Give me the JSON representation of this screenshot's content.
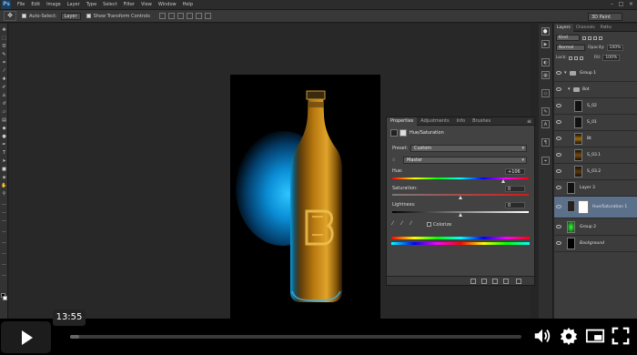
{
  "app": {
    "logo": "Ps",
    "menus": [
      "File",
      "Edit",
      "Image",
      "Layer",
      "Type",
      "Select",
      "Filter",
      "View",
      "Window",
      "Help"
    ],
    "window_controls": [
      "–",
      "□",
      "×"
    ]
  },
  "options_bar": {
    "auto_select_label": "Auto-Select:",
    "auto_select_value": "Layer",
    "show_transform_label": "Show Transform Controls",
    "workspace": "3D Paint"
  },
  "properties_panel": {
    "tabs": [
      "Properties",
      "Adjustments",
      "Info",
      "Brushes"
    ],
    "title": "Hue/Saturation",
    "preset_label": "Preset:",
    "preset_value": "Custom",
    "channel_value": "Master",
    "hue_label": "Hue:",
    "hue_value": "+106",
    "hue_fraction": 0.81,
    "saturation_label": "Saturation:",
    "saturation_value": "0",
    "saturation_fraction": 0.5,
    "lightness_label": "Lightness:",
    "lightness_value": "0",
    "lightness_fraction": 0.5,
    "colorize_label": "Colorize"
  },
  "layers_panel": {
    "tabs": [
      "Layers",
      "Channels",
      "Paths"
    ],
    "kind_label": "Kind",
    "blend_mode": "Normal",
    "opacity_label": "Opacity:",
    "opacity_value": "100%",
    "lock_label": "Lock:",
    "fill_label": "Fill:",
    "fill_value": "100%",
    "layers": [
      {
        "name": "Group 1",
        "type": "group"
      },
      {
        "name": "Bot",
        "type": "group"
      },
      {
        "name": "S_02",
        "type": "layer"
      },
      {
        "name": "S_01",
        "type": "layer"
      },
      {
        "name": "Bt",
        "type": "layer"
      },
      {
        "name": "S_03.1",
        "type": "layer"
      },
      {
        "name": "S_03.2",
        "type": "layer"
      },
      {
        "name": "Layer 3",
        "type": "layer"
      },
      {
        "name": "Hue/Saturation 1",
        "type": "adjustment"
      },
      {
        "name": "Group 2",
        "type": "layer"
      },
      {
        "name": "Background",
        "type": "layer"
      }
    ]
  },
  "player": {
    "timestamp": "13:55",
    "progress_fraction": 0.02
  },
  "colors": {
    "glow": "#2ec4ff",
    "bottle_amber": "#c88a1c",
    "selected_layer": "#5b708a"
  }
}
